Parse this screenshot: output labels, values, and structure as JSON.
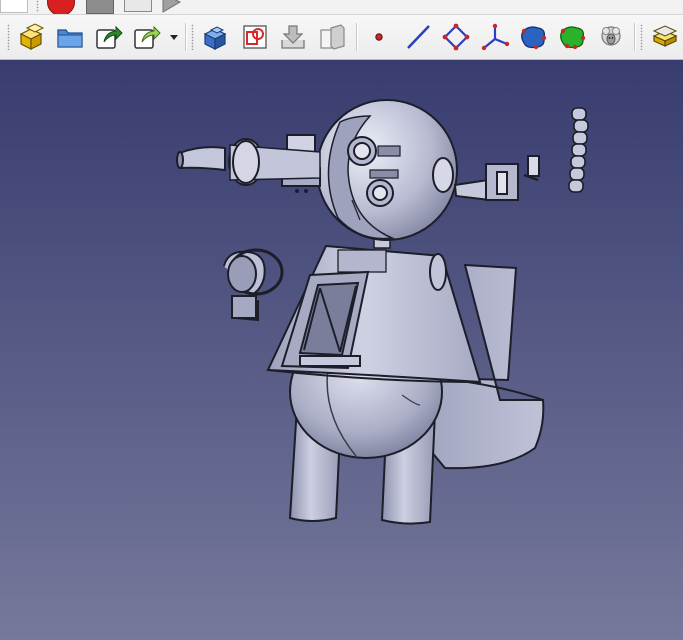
{
  "toolbars": {
    "top_strip": {
      "items": [
        {
          "icon": "record-macro-icon",
          "color": "#d92020"
        },
        {
          "icon": "stop-macro-icon"
        },
        {
          "icon": "macros-icon"
        },
        {
          "icon": "execute-macro-icon"
        }
      ]
    },
    "main": {
      "items": [
        {
          "icon": "part-icon",
          "color": "#f2c500"
        },
        {
          "icon": "group-icon",
          "color": "#4a89d8"
        },
        {
          "icon": "link-icon",
          "color": "#2c8a2c"
        },
        {
          "icon": "link-actions-icon",
          "color": "#2c8a2c"
        },
        {
          "icon": "create-body-icon",
          "color": "#3a6fc2"
        },
        {
          "icon": "create-sketch-icon",
          "color": "#d62a2a"
        },
        {
          "icon": "import-icon"
        },
        {
          "icon": "subshapebinder-icon"
        },
        {
          "icon": "datum-point-icon",
          "color": "#c62828"
        },
        {
          "icon": "datum-line-icon",
          "color": "#2a3fbf"
        },
        {
          "icon": "datum-plane-icon",
          "color": "#2a3fbf"
        },
        {
          "icon": "local-coordinate-system-icon",
          "color": "#2a3fbf"
        },
        {
          "icon": "shape-binder-icon",
          "color": "#2a63c2"
        },
        {
          "icon": "subshape-binder-icon",
          "color": "#2ab22a"
        },
        {
          "icon": "clone-icon"
        },
        {
          "icon": "additive-feature-icon",
          "color": "#f2c500"
        }
      ]
    }
  },
  "viewport": {
    "background_top": "#383c6f",
    "background_bottom": "#76799b",
    "model_color": "#c6c8dc"
  }
}
